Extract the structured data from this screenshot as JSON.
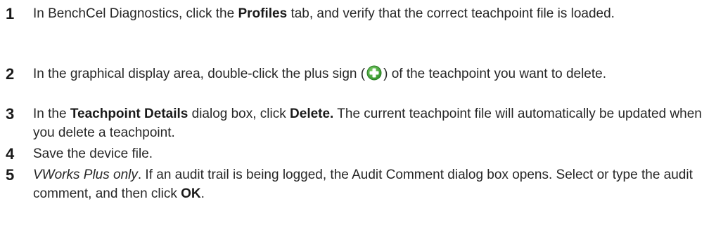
{
  "steps": [
    {
      "number": "1",
      "parts": {
        "a": "In BenchCel Diagnostics, click the ",
        "b": "Profiles",
        "c": " tab, and verify that the correct teachpoint file is loaded."
      }
    },
    {
      "number": "2",
      "parts": {
        "a": "In the graphical display area, double-click the plus sign (",
        "icon": "plus-circle-icon",
        "c": ") of the teachpoint you want to delete."
      }
    },
    {
      "number": "3",
      "parts": {
        "a": "In the ",
        "b": "Teachpoint Details",
        "c": " dialog box, click ",
        "d": "Delete.",
        "e": " The current teachpoint file will automatically be updated when you delete a teachpoint."
      }
    },
    {
      "number": "4",
      "parts": {
        "a": "Save the device file."
      }
    },
    {
      "number": "5",
      "parts": {
        "a": "VWorks Plus only",
        "b": ". If an audit trail is being logged, the Audit Comment dialog box opens. Select or type the audit comment, and then click ",
        "c": "OK",
        "d": "."
      }
    }
  ],
  "colors": {
    "text": "#262626",
    "icon_green": "#3fa535",
    "icon_plus": "#ffffff"
  }
}
